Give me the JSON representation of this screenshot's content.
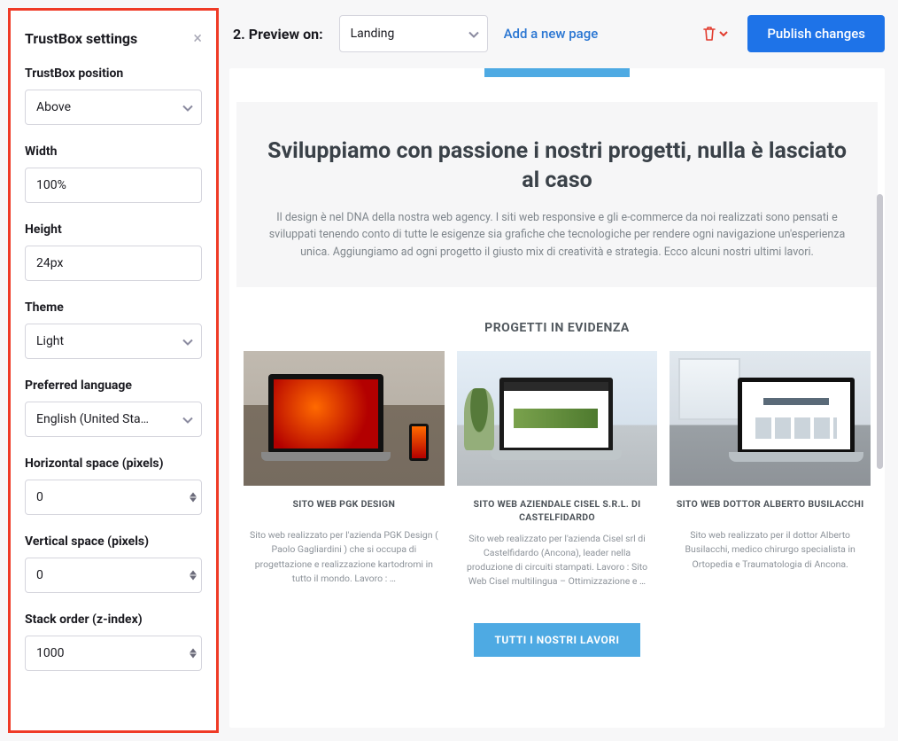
{
  "sidebar": {
    "title": "TrustBox settings",
    "fields": {
      "position": {
        "label": "TrustBox position",
        "value": "Above"
      },
      "width": {
        "label": "Width",
        "value": "100%"
      },
      "height": {
        "label": "Height",
        "value": "24px"
      },
      "theme": {
        "label": "Theme",
        "value": "Light"
      },
      "language": {
        "label": "Preferred language",
        "value": "English (United Sta…"
      },
      "hspace": {
        "label": "Horizontal space (pixels)",
        "value": "0"
      },
      "vspace": {
        "label": "Vertical space (pixels)",
        "value": "0"
      },
      "zindex": {
        "label": "Stack order (z-index)",
        "value": "1000"
      }
    }
  },
  "topbar": {
    "preview_label": "2. Preview on:",
    "page_select_value": "Landing",
    "add_page": "Add a new page",
    "publish": "Publish changes"
  },
  "site": {
    "heading": "Sviluppiamo con passione i nostri progetti, nulla è lasciato al caso",
    "intro": "Il design è nel DNA della nostra web agency. I siti web responsive e gli e-commerce da noi realizzati sono pensati e sviluppati tenendo conto di tutte le esigenze sia grafiche che tecnologiche per rendere ogni navigazione un'esperienza unica. Aggiungiamo ad ogni progetto il giusto mix di creatività e strategia. Ecco alcuni nostri ultimi lavori.",
    "section_title": "PROGETTI IN EVIDENZA",
    "cards": [
      {
        "title": "SITO WEB PGK DESIGN",
        "desc": "Sito web realizzato per l'azienda PGK Design ( Paolo Gagliardini ) che si occupa di progettazione e realizzazione kartodromi in tutto il mondo. Lavoro : …"
      },
      {
        "title": "SITO WEB AZIENDALE CISEL S.R.L. DI CASTELFIDARDO",
        "desc": "Sito web realizzato per l'azienda Cisel srl di Castelfidardo (Ancona), leader nella produzione di circuiti stampati. Lavoro :   Sito Web Cisel multilingua – Ottimizzazione e …"
      },
      {
        "title": "SITO WEB DOTTOR ALBERTO BUSILACCHI",
        "desc": "Sito web realizzato per il dottor Alberto Busilacchi, medico chirurgo specialista in Ortopedia e Traumatologia di Ancona."
      }
    ],
    "all_button": "TUTTI I NOSTRI LAVORI"
  }
}
